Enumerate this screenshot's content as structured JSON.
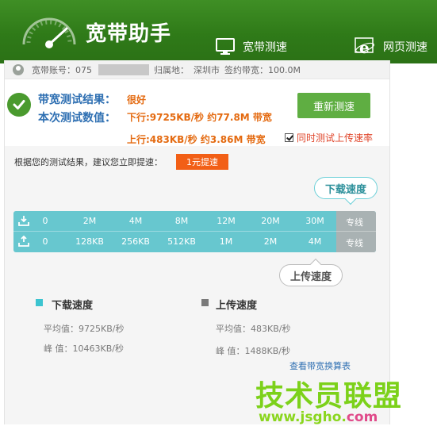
{
  "app": {
    "title": "宽带助手",
    "nav": [
      {
        "label": "宽带测速",
        "icon": "monitor-icon"
      },
      {
        "label": "网页测速",
        "icon": "ie-browser-icon"
      }
    ]
  },
  "account": {
    "number_label": "宽带账号：075",
    "location_label": "归属地：",
    "location_value": "深圳市",
    "contract_label": "签约带宽：100.0M"
  },
  "result": {
    "label_result": "带宽测试结果：",
    "value_result": "很好",
    "label_value": "本次测试数值：",
    "download": "下行:9725KB/秒 约77.8M 带宽",
    "upload": "上行:483KB/秒 约3.86M 带宽",
    "retest_button": "重新测速",
    "upload_checkbox_label": "同时测试上传速率",
    "upload_checkbox_checked": true
  },
  "suggestion": {
    "text": "根据您的测试结果，建议您立即提速：",
    "button": "1元提速"
  },
  "scale": {
    "download_callout": "下载速度",
    "upload_callout": "上传速度",
    "download_ticks": [
      "0",
      "2M",
      "4M",
      "8M",
      "12M",
      "20M",
      "30M",
      "专线"
    ],
    "upload_ticks": [
      "0",
      "128KB",
      "256KB",
      "512KB",
      "1M",
      "2M",
      "4M",
      "专线"
    ]
  },
  "legend": {
    "download": {
      "title": "下载速度",
      "avg": "平均值：9725KB/秒",
      "peak": "峰 值：10463KB/秒",
      "color": "#3cc4d0"
    },
    "upload": {
      "title": "上传速度",
      "avg": "平均值：483KB/秒",
      "peak": "峰 值：1488KB/秒",
      "color": "#7a7a7a"
    },
    "conversion_link": "查看带宽换算表"
  },
  "watermark": {
    "main": "技术员联盟",
    "sub_domain": "www.jsgho.",
    "sub_tld": "com"
  },
  "colors": {
    "header_green": "#2f7a18",
    "accent_teal": "#67c7cf",
    "button_green": "#5fae42",
    "orange": "#f25f16",
    "link_blue": "#2e6fb2"
  }
}
